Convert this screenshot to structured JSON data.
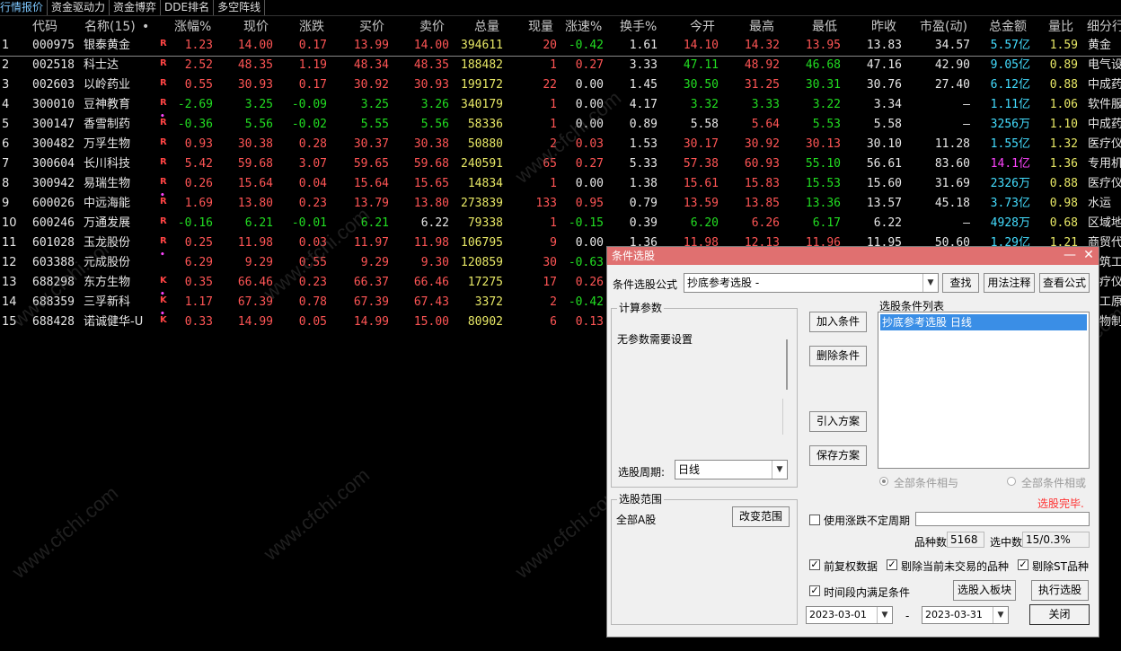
{
  "tabs": [
    "行情报价",
    "资金驱动力",
    "资金博弈",
    "DDE排名",
    "多空阵线"
  ],
  "headers": [
    "代码",
    "名称(15)",
    "•",
    "涨幅%",
    "现价",
    "涨跌",
    "买价",
    "卖价",
    "总量",
    "现量",
    "涨速%",
    "换手%",
    "今开",
    "最高",
    "最低",
    "昨收",
    "市盈(动)",
    "总金额",
    "量比",
    "细分行"
  ],
  "rows": [
    {
      "idx": "1",
      "code": "000975",
      "name": "银泰黄金",
      "mark": "R",
      "dot": false,
      "chg_pct": "1.23",
      "price": "14.00",
      "chg": "0.17",
      "bid": "13.99",
      "ask": "14.00",
      "vol": "394611",
      "cur_vol": "20",
      "speed": "-0.42",
      "turnover": "1.61",
      "open": "14.10",
      "high": "14.32",
      "low": "13.95",
      "prev": "13.83",
      "pe": "34.57",
      "amt_num": "5.57",
      "amt_unit": "亿",
      "vol_ratio": "1.59",
      "industry": "黄金"
    },
    {
      "idx": "2",
      "code": "002518",
      "name": "科士达",
      "mark": "R",
      "dot": false,
      "chg_pct": "2.52",
      "price": "48.35",
      "chg": "1.19",
      "bid": "48.34",
      "ask": "48.35",
      "vol": "188482",
      "cur_vol": "1",
      "speed": "0.27",
      "turnover": "3.33",
      "open": "47.11",
      "high": "48.92",
      "low": "46.68",
      "prev": "47.16",
      "pe": "42.90",
      "amt_num": "9.05",
      "amt_unit": "亿",
      "vol_ratio": "0.89",
      "industry": "电气设"
    },
    {
      "idx": "3",
      "code": "002603",
      "name": "以岭药业",
      "mark": "R",
      "dot": false,
      "chg_pct": "0.55",
      "price": "30.93",
      "chg": "0.17",
      "bid": "30.92",
      "ask": "30.93",
      "vol": "199172",
      "cur_vol": "22",
      "speed": "0.00",
      "turnover": "1.45",
      "open": "30.50",
      "high": "31.25",
      "low": "30.31",
      "prev": "30.76",
      "pe": "27.40",
      "amt_num": "6.12",
      "amt_unit": "亿",
      "vol_ratio": "0.88",
      "industry": "中成药"
    },
    {
      "idx": "4",
      "code": "300010",
      "name": "豆神教育",
      "mark": "R",
      "dot": false,
      "chg_pct": "-2.69",
      "price": "3.25",
      "chg": "-0.09",
      "bid": "3.25",
      "ask": "3.26",
      "vol": "340179",
      "cur_vol": "1",
      "speed": "0.00",
      "turnover": "4.17",
      "open": "3.32",
      "high": "3.33",
      "low": "3.22",
      "prev": "3.34",
      "pe": "–",
      "amt_num": "1.11",
      "amt_unit": "亿",
      "vol_ratio": "1.06",
      "industry": "软件服"
    },
    {
      "idx": "5",
      "code": "300147",
      "name": "香雪制药",
      "mark": "R",
      "dot": true,
      "chg_pct": "-0.36",
      "price": "5.56",
      "chg": "-0.02",
      "bid": "5.55",
      "ask": "5.56",
      "vol": "58336",
      "cur_vol": "1",
      "speed": "0.00",
      "turnover": "0.89",
      "open": "5.58",
      "high": "5.64",
      "low": "5.53",
      "prev": "5.58",
      "pe": "–",
      "amt_num": "3256",
      "amt_unit": "万",
      "vol_ratio": "1.10",
      "industry": "中成药"
    },
    {
      "idx": "6",
      "code": "300482",
      "name": "万孚生物",
      "mark": "R",
      "dot": false,
      "chg_pct": "0.93",
      "price": "30.38",
      "chg": "0.28",
      "bid": "30.37",
      "ask": "30.38",
      "vol": "50880",
      "cur_vol": "2",
      "speed": "0.03",
      "turnover": "1.53",
      "open": "30.17",
      "high": "30.92",
      "low": "30.13",
      "prev": "30.10",
      "pe": "11.28",
      "amt_num": "1.55",
      "amt_unit": "亿",
      "vol_ratio": "1.32",
      "industry": "医疗仪"
    },
    {
      "idx": "7",
      "code": "300604",
      "name": "长川科技",
      "mark": "R",
      "dot": false,
      "chg_pct": "5.42",
      "price": "59.68",
      "chg": "3.07",
      "bid": "59.65",
      "ask": "59.68",
      "vol": "240591",
      "cur_vol": "65",
      "speed": "0.27",
      "turnover": "5.33",
      "open": "57.38",
      "high": "60.93",
      "low": "55.10",
      "prev": "56.61",
      "pe": "83.60",
      "amt_num": "14.1",
      "amt_unit": "亿",
      "vol_ratio": "1.36",
      "industry": "专用机"
    },
    {
      "idx": "8",
      "code": "300942",
      "name": "易瑞生物",
      "mark": "R",
      "dot": false,
      "chg_pct": "0.26",
      "price": "15.64",
      "chg": "0.04",
      "bid": "15.64",
      "ask": "15.65",
      "vol": "14834",
      "cur_vol": "1",
      "speed": "0.00",
      "turnover": "1.38",
      "open": "15.61",
      "high": "15.83",
      "low": "15.53",
      "prev": "15.60",
      "pe": "31.69",
      "amt_num": "2326",
      "amt_unit": "万",
      "vol_ratio": "0.88",
      "industry": "医疗仪"
    },
    {
      "idx": "9",
      "code": "600026",
      "name": "中远海能",
      "mark": "R",
      "dot": true,
      "chg_pct": "1.69",
      "price": "13.80",
      "chg": "0.23",
      "bid": "13.79",
      "ask": "13.80",
      "vol": "273839",
      "cur_vol": "133",
      "speed": "0.95",
      "turnover": "0.79",
      "open": "13.59",
      "high": "13.85",
      "low": "13.36",
      "prev": "13.57",
      "pe": "45.18",
      "amt_num": "3.73",
      "amt_unit": "亿",
      "vol_ratio": "0.98",
      "industry": "水运"
    },
    {
      "idx": "10",
      "code": "600246",
      "name": "万通发展",
      "mark": "R",
      "dot": false,
      "chg_pct": "-0.16",
      "price": "6.21",
      "chg": "-0.01",
      "bid": "6.21",
      "ask": "6.22",
      "vol": "79338",
      "cur_vol": "1",
      "speed": "-0.15",
      "turnover": "0.39",
      "open": "6.20",
      "high": "6.26",
      "low": "6.17",
      "prev": "6.22",
      "pe": "–",
      "amt_num": "4928",
      "amt_unit": "万",
      "vol_ratio": "0.68",
      "industry": "区域地"
    },
    {
      "idx": "11",
      "code": "601028",
      "name": "玉龙股份",
      "mark": "R",
      "dot": false,
      "chg_pct": "0.25",
      "price": "11.98",
      "chg": "0.03",
      "bid": "11.97",
      "ask": "11.98",
      "vol": "106795",
      "cur_vol": "9",
      "speed": "0.00",
      "turnover": "1.36",
      "open": "11.98",
      "high": "12.13",
      "low": "11.96",
      "prev": "11.95",
      "pe": "50.60",
      "amt_num": "1.29",
      "amt_unit": "亿",
      "vol_ratio": "1.21",
      "industry": "商贸代"
    },
    {
      "idx": "12",
      "code": "603388",
      "name": "元成股份",
      "mark": "",
      "dot": true,
      "chg_pct": "6.29",
      "price": "9.29",
      "chg": "0.55",
      "bid": "9.29",
      "ask": "9.30",
      "vol": "120859",
      "cur_vol": "30",
      "speed": "-0.63",
      "turnover": "",
      "open": "",
      "high": "",
      "low": "",
      "prev": "",
      "pe": "",
      "amt_num": "",
      "amt_unit": "",
      "vol_ratio": "",
      "industry": "建筑工"
    },
    {
      "idx": "13",
      "code": "688298",
      "name": "东方生物",
      "mark": "K",
      "dot": false,
      "chg_pct": "0.35",
      "price": "66.46",
      "chg": "0.23",
      "bid": "66.37",
      "ask": "66.46",
      "vol": "17275",
      "cur_vol": "17",
      "speed": "0.26",
      "turnover": "",
      "open": "",
      "high": "",
      "low": "",
      "prev": "",
      "pe": "",
      "amt_num": "",
      "amt_unit": "",
      "vol_ratio": "",
      "industry": "医疗仪"
    },
    {
      "idx": "14",
      "code": "688359",
      "name": "三孚新科",
      "mark": "K",
      "dot": true,
      "chg_pct": "1.17",
      "price": "67.39",
      "chg": "0.78",
      "bid": "67.39",
      "ask": "67.43",
      "vol": "3372",
      "cur_vol": "2",
      "speed": "-0.42",
      "turnover": "",
      "open": "",
      "high": "",
      "low": "",
      "prev": "",
      "pe": "",
      "amt_num": "",
      "amt_unit": "",
      "vol_ratio": "",
      "industry": "化工原"
    },
    {
      "idx": "15",
      "code": "688428",
      "name": "诺诚健华-U",
      "mark": "K",
      "dot": true,
      "chg_pct": "0.33",
      "price": "14.99",
      "chg": "0.05",
      "bid": "14.99",
      "ask": "15.00",
      "vol": "80902",
      "cur_vol": "6",
      "speed": "0.13",
      "turnover": "",
      "open": "",
      "high": "",
      "low": "",
      "prev": "",
      "pe": "",
      "amt_num": "",
      "amt_unit": "",
      "vol_ratio": "",
      "industry": "生物制"
    }
  ],
  "dialog": {
    "title": "条件选股",
    "formula_label": "条件选股公式",
    "formula_value": "抄底参考选股 -",
    "btn_find": "查找",
    "btn_usage": "用法注释",
    "btn_view": "查看公式",
    "calc_params_title": "计算参数",
    "no_params": "无参数需要设置",
    "period_label": "选股周期:",
    "period_value": "日线",
    "btn_add": "加入条件",
    "btn_delete": "删除条件",
    "btn_import": "引入方案",
    "btn_save": "保存方案",
    "cond_list_title": "选股条件列表",
    "cond_item": "抄底参考选股  日线",
    "radio_and": "全部条件相与",
    "radio_or": "全部条件相或",
    "status": "选股完毕.",
    "range_title": "选股范围",
    "range_value": "全部A股",
    "btn_change_range": "改变范围",
    "use_variable_period": "使用涨跌不定周期",
    "count_label": "品种数",
    "count_value": "5168",
    "selected_label": "选中数",
    "selected_value": "15/0.3%",
    "cb_adjust": "前复权数据",
    "cb_exclude_untraded": "剔除当前未交易的品种",
    "cb_exclude_st": "剔除ST品种",
    "cb_time_range": "时间段内满足条件",
    "btn_to_block": "选股入板块",
    "btn_execute": "执行选股",
    "date_from": "2023-03-01",
    "date_sep": "-",
    "date_to": "2023-03-31",
    "btn_close": "关闭"
  },
  "watermark": "www.cfchi.com",
  "colors": {
    "up": "#ff5555",
    "down": "#22dd22",
    "price_volume": "#e8e866",
    "amount": "#44ddff",
    "title_bar": "#e07070",
    "selection": "#3a8ee6",
    "status": "#ff3030"
  }
}
